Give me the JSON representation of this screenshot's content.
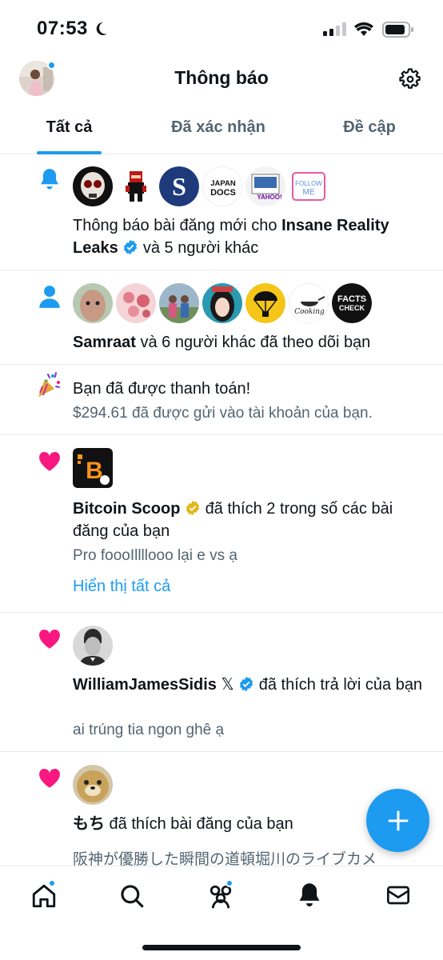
{
  "status_bar": {
    "time": "07:53"
  },
  "header": {
    "title": "Thông báo"
  },
  "tabs": [
    {
      "label": "Tất cả",
      "active": true
    },
    {
      "label": "Đã xác nhận",
      "active": false
    },
    {
      "label": "Đề cập",
      "active": false
    }
  ],
  "notifications": {
    "n1": {
      "icon": "bell-icon",
      "avatar_texts": {
        "japan_docs_line1": "JAPAN",
        "japan_docs_line2": "DOCS",
        "yahoo": "YAHOO!",
        "follow_line1": "FOLLOW",
        "follow_line2": "ME"
      },
      "text_prefix": "Thông báo bài đăng mới cho ",
      "name": "Insane Reality Leaks",
      "text_suffix": " và 5 người khác"
    },
    "n2": {
      "icon": "person-icon",
      "avatar_texts": {
        "facts": "FACTS",
        "check": "CHECK",
        "cooking": "Cooking"
      },
      "name": "Samraat",
      "text_suffix": " và 6 người khác đã theo dõi bạn"
    },
    "n3": {
      "icon": "party-popper-icon",
      "text": "Bạn đã được thanh toán!",
      "sub": "$294.61 đã được gửi vào tài khoản của bạn."
    },
    "n4": {
      "icon": "heart-icon",
      "avatar_letter": "B",
      "name": "Bitcoin Scoop",
      "text_suffix": " đã thích 2 trong số các bài đăng của bạn",
      "sub": "Pro foooIllllooo lại e vs ạ",
      "link": "Hiển thị tất cả"
    },
    "n5": {
      "icon": "heart-icon",
      "name": "WilliamJamesSidis",
      "x_mark": "𝕏",
      "text_suffix": " đã thích trả lời của bạn",
      "sub": "ai trúng tia ngon ghê ạ"
    },
    "n6": {
      "icon": "heart-icon",
      "name": "もち",
      "text_suffix": " đã thích bài đăng của bạn",
      "sub": "阪神が優勝した瞬間の道頓堀川のライブカメ"
    }
  },
  "colors": {
    "accent": "#1d9bf0",
    "heart": "#f91880",
    "gold": "#e2b719",
    "text": "#0f1419",
    "muted": "#536471"
  }
}
